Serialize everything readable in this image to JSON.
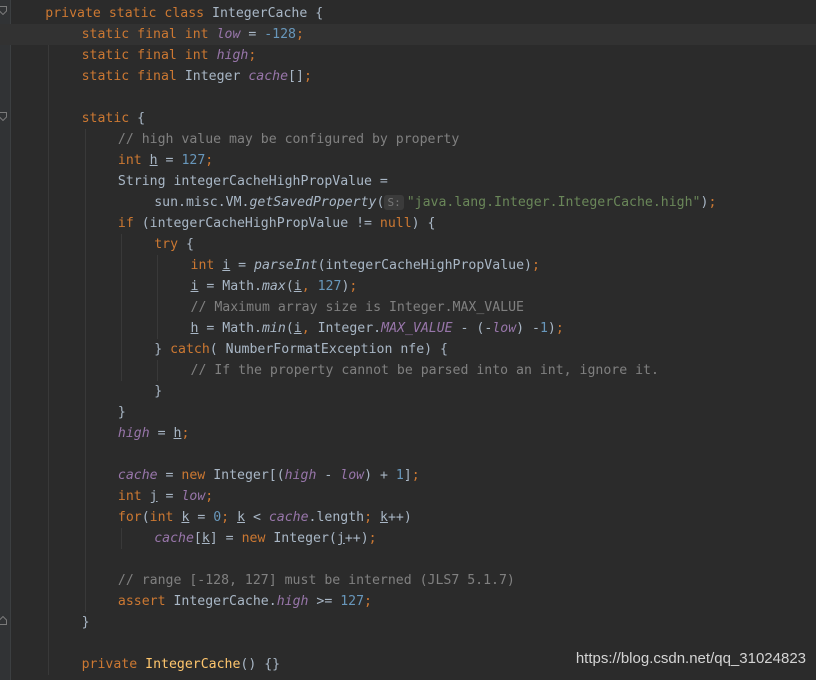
{
  "editor": {
    "lines": [
      {
        "indent": 1,
        "parts": [
          [
            "kw",
            "private static class "
          ],
          [
            "pl",
            "IntegerCache {"
          ]
        ]
      },
      {
        "indent": 2,
        "current": true,
        "parts": [
          [
            "kw",
            "static final int "
          ],
          [
            "fld",
            "low"
          ],
          [
            "pl",
            " = "
          ],
          [
            "num",
            "-128"
          ],
          [
            "kw",
            ";"
          ]
        ]
      },
      {
        "indent": 2,
        "parts": [
          [
            "kw",
            "static final int "
          ],
          [
            "fld",
            "high"
          ],
          [
            "kw",
            ";"
          ]
        ]
      },
      {
        "indent": 2,
        "parts": [
          [
            "kw",
            "static final "
          ],
          [
            "pl",
            "Integer "
          ],
          [
            "fld",
            "cache"
          ],
          [
            "pl",
            "[]"
          ],
          [
            "kw",
            ";"
          ]
        ]
      },
      {
        "indent": 0,
        "parts": []
      },
      {
        "indent": 2,
        "parts": [
          [
            "kw",
            "static "
          ],
          [
            "pl",
            "{"
          ]
        ]
      },
      {
        "indent": 3,
        "parts": [
          [
            "cm",
            "// high value may be configured by property"
          ]
        ]
      },
      {
        "indent": 3,
        "parts": [
          [
            "kw",
            "int "
          ],
          [
            "ulpl",
            "h"
          ],
          [
            "pl",
            " = "
          ],
          [
            "num",
            "127"
          ],
          [
            "kw",
            ";"
          ]
        ]
      },
      {
        "indent": 3,
        "parts": [
          [
            "pl",
            "String integerCacheHighPropValue ="
          ]
        ]
      },
      {
        "indent": 4,
        "parts": [
          [
            "pl",
            "sun.misc.VM."
          ],
          [
            "it",
            "getSavedProperty"
          ],
          [
            "pl",
            "("
          ],
          [
            "hint",
            "S:"
          ],
          [
            "str",
            "\"java.lang.Integer.IntegerCache.high\""
          ],
          [
            "pl",
            ")"
          ],
          [
            "kw",
            ";"
          ]
        ]
      },
      {
        "indent": 3,
        "parts": [
          [
            "kw",
            "if "
          ],
          [
            "pl",
            "(integerCacheHighPropValue != "
          ],
          [
            "kw",
            "null"
          ],
          [
            "pl",
            ") {"
          ]
        ]
      },
      {
        "indent": 4,
        "parts": [
          [
            "kw",
            "try "
          ],
          [
            "pl",
            "{"
          ]
        ]
      },
      {
        "indent": 5,
        "parts": [
          [
            "kw",
            "int "
          ],
          [
            "ulpl",
            "i"
          ],
          [
            "pl",
            " = "
          ],
          [
            "it",
            "parseInt"
          ],
          [
            "pl",
            "(integerCacheHighPropValue)"
          ],
          [
            "kw",
            ";"
          ]
        ]
      },
      {
        "indent": 5,
        "parts": [
          [
            "ulpl",
            "i"
          ],
          [
            "pl",
            " = Math."
          ],
          [
            "it",
            "max"
          ],
          [
            "pl",
            "("
          ],
          [
            "ulpl",
            "i"
          ],
          [
            "kw",
            ", "
          ],
          [
            "num",
            "127"
          ],
          [
            "pl",
            ")"
          ],
          [
            "kw",
            ";"
          ]
        ]
      },
      {
        "indent": 5,
        "parts": [
          [
            "cm",
            "// Maximum array size is Integer.MAX_VALUE"
          ]
        ]
      },
      {
        "indent": 5,
        "parts": [
          [
            "ulpl",
            "h"
          ],
          [
            "pl",
            " = Math."
          ],
          [
            "it",
            "min"
          ],
          [
            "pl",
            "("
          ],
          [
            "ulpl",
            "i"
          ],
          [
            "kw",
            ", "
          ],
          [
            "pl",
            "Integer."
          ],
          [
            "sfld",
            "MAX_VALUE"
          ],
          [
            "pl",
            " - (-"
          ],
          [
            "fld",
            "low"
          ],
          [
            "pl",
            ") -"
          ],
          [
            "num",
            "1"
          ],
          [
            "pl",
            ")"
          ],
          [
            "kw",
            ";"
          ]
        ]
      },
      {
        "indent": 4,
        "parts": [
          [
            "pl",
            "} "
          ],
          [
            "kw",
            "catch"
          ],
          [
            "pl",
            "( NumberFormatException nfe) {"
          ]
        ]
      },
      {
        "indent": 5,
        "parts": [
          [
            "cm",
            "// If the property cannot be parsed into an int, ignore it."
          ]
        ]
      },
      {
        "indent": 4,
        "parts": [
          [
            "pl",
            "}"
          ]
        ]
      },
      {
        "indent": 3,
        "parts": [
          [
            "pl",
            "}"
          ]
        ]
      },
      {
        "indent": 3,
        "parts": [
          [
            "fld",
            "high"
          ],
          [
            "pl",
            " = "
          ],
          [
            "ulpl",
            "h"
          ],
          [
            "kw",
            ";"
          ]
        ]
      },
      {
        "indent": 0,
        "parts": []
      },
      {
        "indent": 3,
        "parts": [
          [
            "fld",
            "cache"
          ],
          [
            "pl",
            " = "
          ],
          [
            "kw",
            "new "
          ],
          [
            "pl",
            "Integer[("
          ],
          [
            "fld",
            "high"
          ],
          [
            "pl",
            " - "
          ],
          [
            "fld",
            "low"
          ],
          [
            "pl",
            ") + "
          ],
          [
            "num",
            "1"
          ],
          [
            "pl",
            "]"
          ],
          [
            "kw",
            ";"
          ]
        ]
      },
      {
        "indent": 3,
        "parts": [
          [
            "kw",
            "int "
          ],
          [
            "ulpl",
            "j"
          ],
          [
            "pl",
            " = "
          ],
          [
            "fld",
            "low"
          ],
          [
            "kw",
            ";"
          ]
        ]
      },
      {
        "indent": 3,
        "parts": [
          [
            "kw",
            "for"
          ],
          [
            "pl",
            "("
          ],
          [
            "kw",
            "int "
          ],
          [
            "ulpl",
            "k"
          ],
          [
            "pl",
            " = "
          ],
          [
            "num",
            "0"
          ],
          [
            "kw",
            "; "
          ],
          [
            "ulpl",
            "k"
          ],
          [
            "pl",
            " < "
          ],
          [
            "fld",
            "cache"
          ],
          [
            "pl",
            ".length"
          ],
          [
            "kw",
            "; "
          ],
          [
            "ulpl",
            "k"
          ],
          [
            "pl",
            "++)"
          ]
        ]
      },
      {
        "indent": 4,
        "parts": [
          [
            "fld",
            "cache"
          ],
          [
            "pl",
            "["
          ],
          [
            "ulpl",
            "k"
          ],
          [
            "pl",
            "] = "
          ],
          [
            "kw",
            "new "
          ],
          [
            "pl",
            "Integer("
          ],
          [
            "ulpl",
            "j"
          ],
          [
            "pl",
            "++)"
          ],
          [
            "kw",
            ";"
          ]
        ]
      },
      {
        "indent": 0,
        "parts": []
      },
      {
        "indent": 3,
        "parts": [
          [
            "cm",
            "// range [-128, 127] must be interned (JLS7 5.1.7)"
          ]
        ]
      },
      {
        "indent": 3,
        "parts": [
          [
            "kw",
            "assert "
          ],
          [
            "pl",
            "IntegerCache."
          ],
          [
            "fld",
            "high"
          ],
          [
            "pl",
            " >= "
          ],
          [
            "num",
            "127"
          ],
          [
            "kw",
            ";"
          ]
        ]
      },
      {
        "indent": 2,
        "parts": [
          [
            "pl",
            "}"
          ]
        ]
      },
      {
        "indent": 0,
        "parts": []
      },
      {
        "indent": 2,
        "parts": [
          [
            "kw",
            "private "
          ],
          [
            "mth",
            "IntegerCache"
          ],
          [
            "pl",
            "() {}"
          ]
        ]
      }
    ]
  },
  "watermark": "https://blog.csdn.net/qq_31024823"
}
